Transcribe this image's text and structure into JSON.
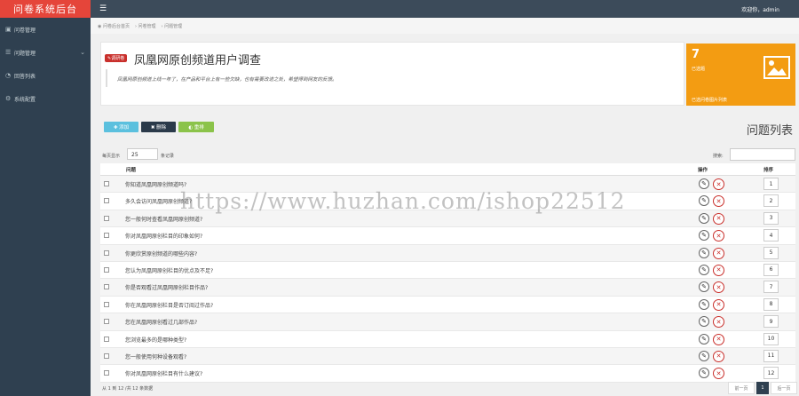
{
  "sidebar": {
    "logo": "问卷系统后台",
    "items": [
      {
        "icon": "▣",
        "icon_name": "survey-icon",
        "label": "问卷管理",
        "arrow": ""
      },
      {
        "icon": "☰",
        "icon_name": "list-icon",
        "label": "问题管理",
        "arrow": "⌄"
      },
      {
        "icon": "◔",
        "icon_name": "chart-icon",
        "label": "回答列表",
        "arrow": ""
      },
      {
        "icon": "⚙",
        "icon_name": "gear-icon",
        "label": "系统配置",
        "arrow": ""
      }
    ]
  },
  "topbar": {
    "menu_icon": "☰",
    "welcome": "欢迎你，admin"
  },
  "breadcrumb": [
    "◉ 问卷后台首页",
    "›  问卷管理",
    "›  问题管理"
  ],
  "survey": {
    "tag": "✎调研卷",
    "title": "凤凰网原创频道用户调查",
    "description": "凤凰网原创频道上线一年了，在产品和平台上有一些欠缺，也有需要改进之处，希望得到网友的反馈。"
  },
  "stat": {
    "number": "7",
    "label": "已选题",
    "link": "已选问卷图片列表"
  },
  "toolbar": {
    "add": "✚ 添加",
    "delete": "✖ 删除",
    "reset": "◐ 重排"
  },
  "list": {
    "title": "问题列表",
    "per_page_prefix": "每页显示",
    "per_page_value": "25",
    "per_page_suffix": "条记录",
    "search_label": "搜索:",
    "headers": {
      "title": "问题",
      "ops": "操作",
      "sort": "排序"
    },
    "rows": [
      {
        "q": "你知道凤凰网原创频道吗?",
        "sort": "1"
      },
      {
        "q": "多久会访问凤凰网原创频道?",
        "sort": "2"
      },
      {
        "q": "您一般何时查看凤凰网原创频道?",
        "sort": "3"
      },
      {
        "q": "你对凤凰网原创栏目的印象如何?",
        "sort": "4"
      },
      {
        "q": "你更欣赏原创频道的哪些内容?",
        "sort": "5"
      },
      {
        "q": "您认为凤凰网原创栏目的优点及不足?",
        "sort": "6"
      },
      {
        "q": "你是否观看过凤凰网原创栏目作品?",
        "sort": "7"
      },
      {
        "q": "你在凤凰网原创栏目是否订阅过作品?",
        "sort": "8"
      },
      {
        "q": "您在凤凰网原创看过几部作品?",
        "sort": "9"
      },
      {
        "q": "您浏览最多的是哪种类型?",
        "sort": "10"
      },
      {
        "q": "您一般使用何种设备观看?",
        "sort": "11"
      },
      {
        "q": "你对凤凰网原创栏目有什么建议?",
        "sort": "12"
      }
    ],
    "footer": "从 1 到 12 /共 12 条数据",
    "pager": {
      "prev": "前一页",
      "current": "1",
      "next": "后一页"
    }
  },
  "watermark": "https://www.huzhan.com/ishop22512"
}
